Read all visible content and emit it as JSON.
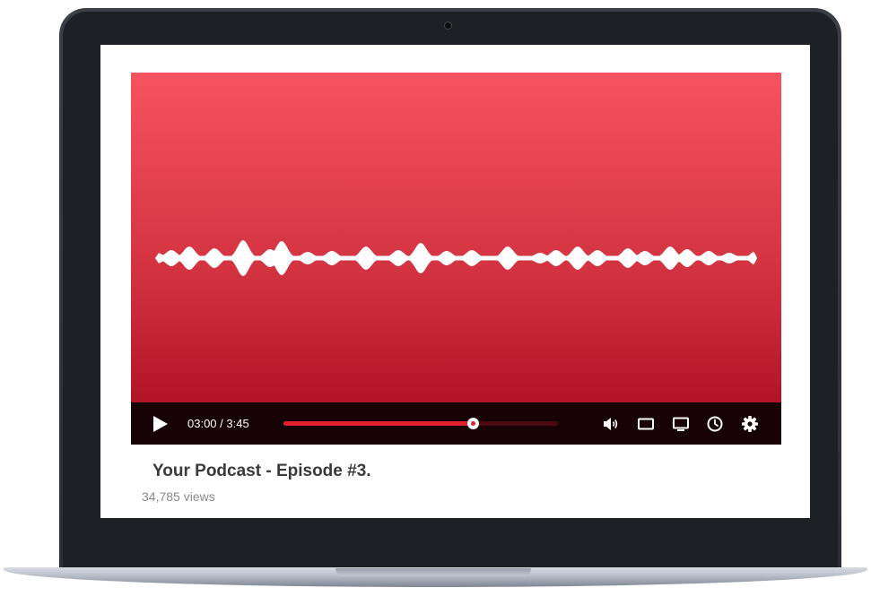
{
  "player": {
    "time_current": "03:00",
    "time_total": "3:45",
    "progress_fraction": 0.69,
    "play_icon": "play-icon",
    "controls_icons": [
      "volume-icon",
      "miniplayer-icon",
      "cast-icon",
      "clock-icon",
      "gear-icon"
    ]
  },
  "video": {
    "title": "Your Podcast - Episode #3.",
    "views": "34,785 views"
  },
  "colors": {
    "accent": "#e3202f",
    "gradient_top": "#f5545f",
    "gradient_bottom": "#a70b1e",
    "controls_bg": "#170306"
  }
}
